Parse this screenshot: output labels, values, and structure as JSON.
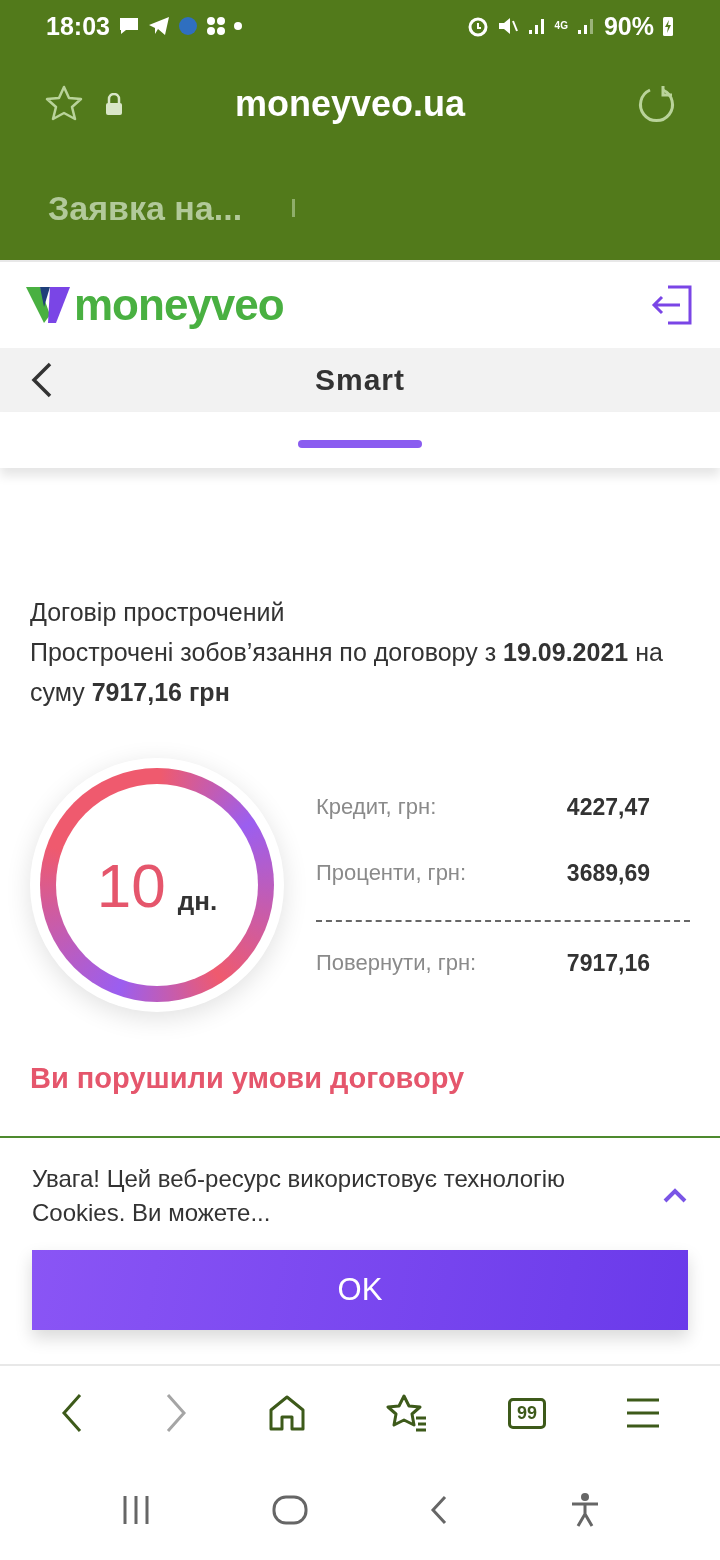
{
  "status_bar": {
    "time": "18:03",
    "network": "4G",
    "battery": "90%"
  },
  "browser": {
    "url": "moneyveo.ua",
    "tab_title": "Заявка на..."
  },
  "header": {
    "logo": "moneyveo"
  },
  "page": {
    "title": "Smart"
  },
  "contract": {
    "status": "Договір прострочений",
    "details": "Прострочені зобов’язання по договору з **19.09.2021** на суму **7917,16 грн**"
  },
  "days": {
    "number": "10",
    "unit": "дн."
  },
  "breakdown": [
    {
      "kind": "item",
      "label": "Кредит, грн:",
      "value": "4227,47"
    },
    {
      "kind": "item",
      "label": "Проценти, грн:",
      "value": "3689,69"
    },
    {
      "kind": "total",
      "label": "Повернути, грн:",
      "value": "7917,16"
    }
  ],
  "warning": "Ви порушили умови договору",
  "cookie": {
    "text": "Увага! Цей веб-ресурс використовує технологію Cookies. Ви можете...",
    "button": "OK"
  },
  "browser_nav": {
    "tabs_count": "99"
  }
}
